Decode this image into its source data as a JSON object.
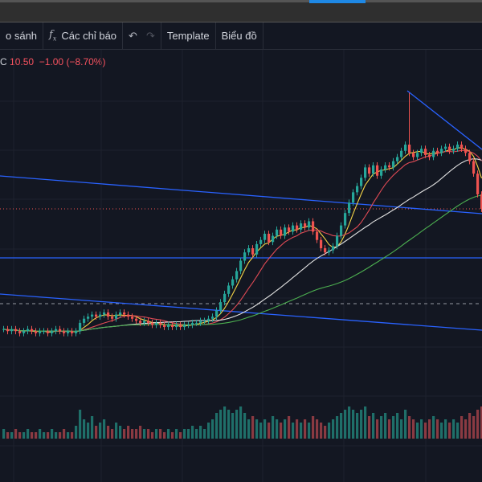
{
  "toolbar": {
    "compare_label": "o sánh",
    "indicators_label": "Các chỉ báo",
    "indicators_icon": "function-fx-icon",
    "undo_icon": "undo-icon",
    "redo_icon": "redo-icon",
    "template_label": "Template",
    "chart_label": "Biểu đồ"
  },
  "legend": {
    "symbol_tail": "C",
    "close": "10.50",
    "change": "−1.00",
    "change_pct": "(−8.70%)"
  },
  "colors": {
    "up": "#26a69a",
    "down": "#ef5350",
    "bg": "#131722",
    "trendline": "#2962ff",
    "ma_fast": "#f5d547",
    "ma_mid": "#e04a55",
    "ma_slow": "#e0e0e0",
    "ma_long": "#4caf50"
  },
  "chart_data": {
    "type": "candlestick",
    "last_price": 10.5,
    "closes": [
      4.7,
      4.6,
      4.7,
      4.6,
      4.5,
      4.6,
      4.7,
      4.6,
      4.5,
      4.6,
      4.6,
      4.5,
      4.6,
      4.7,
      4.6,
      4.5,
      4.6,
      4.5,
      4.6,
      5.0,
      5.2,
      5.3,
      5.4,
      5.3,
      5.4,
      5.5,
      5.3,
      5.2,
      5.4,
      5.5,
      5.4,
      5.3,
      5.2,
      5.1,
      5.0,
      5.1,
      5.0,
      4.9,
      5.0,
      4.9,
      4.8,
      4.9,
      4.8,
      4.9,
      4.8,
      4.9,
      4.9,
      5.0,
      5.0,
      5.1,
      5.1,
      5.2,
      5.3,
      5.6,
      6.0,
      6.4,
      6.8,
      7.1,
      7.5,
      8.0,
      8.4,
      8.6,
      8.3,
      8.8,
      9.0,
      9.3,
      8.9,
      9.2,
      9.5,
      9.2,
      9.6,
      9.4,
      9.7,
      9.5,
      9.8,
      9.6,
      9.9,
      9.4,
      9.0,
      8.6,
      8.4,
      8.5,
      8.7,
      9.2,
      9.7,
      10.3,
      10.8,
      11.3,
      11.6,
      12.0,
      12.5,
      12.2,
      12.6,
      12.1,
      12.4,
      12.6,
      12.5,
      12.8,
      13.0,
      13.3,
      13.6,
      13.2,
      13.0,
      13.2,
      13.4,
      13.1,
      13.0,
      13.3,
      13.2,
      13.4,
      13.5,
      13.3,
      13.4,
      13.6,
      13.4,
      13.2,
      12.8,
      12.2,
      11.2,
      10.5
    ],
    "high_overrides": {
      "101": 16.1
    },
    "volumes": [
      3,
      2,
      2,
      3,
      2,
      2,
      3,
      2,
      2,
      3,
      2,
      2,
      3,
      2,
      2,
      3,
      2,
      2,
      4,
      9,
      6,
      5,
      7,
      4,
      5,
      6,
      4,
      3,
      5,
      4,
      3,
      4,
      3,
      3,
      4,
      3,
      3,
      2,
      3,
      3,
      2,
      3,
      2,
      3,
      2,
      3,
      3,
      4,
      3,
      4,
      3,
      5,
      6,
      8,
      9,
      10,
      9,
      8,
      9,
      10,
      8,
      6,
      7,
      6,
      5,
      6,
      5,
      7,
      6,
      5,
      6,
      7,
      5,
      6,
      5,
      6,
      5,
      7,
      6,
      5,
      4,
      5,
      6,
      7,
      8,
      9,
      10,
      9,
      8,
      9,
      10,
      7,
      8,
      6,
      7,
      8,
      6,
      7,
      8,
      6,
      9,
      7,
      6,
      5,
      6,
      5,
      6,
      7,
      6,
      5,
      6,
      5,
      6,
      5,
      7,
      6,
      8,
      7,
      9,
      10
    ]
  }
}
